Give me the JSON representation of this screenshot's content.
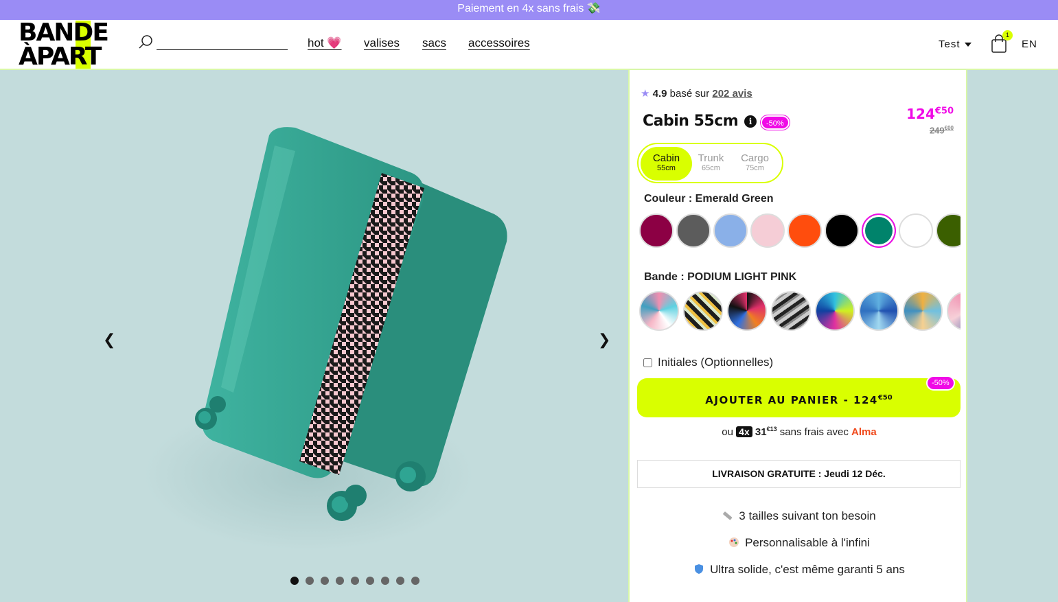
{
  "promo_banner": "Paiement en 4x sans frais 💸",
  "logo": {
    "line1": "BANDE",
    "line2": "ÀPART"
  },
  "search": {
    "placeholder": ""
  },
  "nav": {
    "hot": "hot 💗",
    "valises": "valises",
    "sacs": "sacs",
    "accessoires": "accessoires"
  },
  "account": {
    "name": "Test"
  },
  "cart": {
    "count": "1"
  },
  "language": "EN",
  "gallery": {
    "prev": "❮",
    "next": "❯",
    "slide_count": 9,
    "active_slide": 1
  },
  "product": {
    "rating_value": "4.9",
    "rating_text": "basé sur",
    "reviews_link": "202 avis",
    "title": "Cabin 55cm",
    "info_icon": "i",
    "discount_badge": "-50%",
    "price_main": "124",
    "price_cents": "€50",
    "old_price_main": "249",
    "old_price_cents": "€00",
    "sizes": [
      {
        "name": "Cabin",
        "cm": "55cm",
        "selected": true
      },
      {
        "name": "Trunk",
        "cm": "65cm",
        "selected": false
      },
      {
        "name": "Cargo",
        "cm": "75cm",
        "selected": false
      }
    ],
    "color_label": "Couleur : Emerald Green",
    "colors": [
      "#8c0044",
      "#5c5c5c",
      "#8ab0e8",
      "#f5cdd6",
      "#ff4d0d",
      "#000000",
      "#00836b",
      "#ffffff",
      "#3b5f00"
    ],
    "selected_color": "#00836b",
    "band_label": "Bande : PODIUM LIGHT PINK",
    "initials_label": "Initiales (Optionnelles)",
    "add_to_cart_main": "AJOUTER AU PANIER - 124",
    "add_to_cart_cents": "€50",
    "add_to_cart_badge": "-50%",
    "alma": {
      "prefix": "ou",
      "times": "4x",
      "amount": "31",
      "amount_cents": "€13",
      "suffix": "sans frais avec",
      "brand": "Alma"
    },
    "delivery": "LIVRAISON GRATUITE : Jeudi 12 Déc.",
    "features": [
      {
        "icon": "ruler-icon",
        "text": "3 tailles suivant ton besoin"
      },
      {
        "icon": "palette-icon",
        "text": "Personnalisable à l'infini"
      },
      {
        "icon": "shield-icon",
        "text": "Ultra solide, c'est même garanti 5 ans"
      }
    ]
  }
}
